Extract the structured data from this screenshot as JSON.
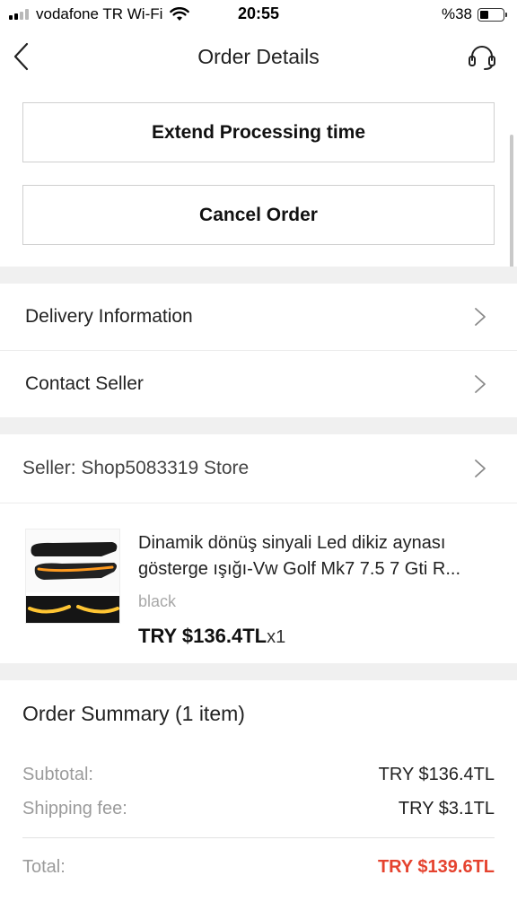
{
  "status_bar": {
    "carrier": "vodafone TR Wi-Fi",
    "time": "20:55",
    "battery_percent": "%38",
    "battery_level": 0.38,
    "signal_bars_active": 2,
    "icons": [
      "signal-icon",
      "wifi-icon",
      "battery-icon"
    ]
  },
  "header": {
    "title": "Order Details",
    "back_icon": "chevron-left-icon",
    "support_icon": "headset-icon"
  },
  "actions": {
    "extend_label": "Extend Processing time",
    "cancel_label": "Cancel Order"
  },
  "links": {
    "delivery_label": "Delivery Information",
    "contact_label": "Contact Seller"
  },
  "seller": {
    "label": "Seller: Shop5083319 Store"
  },
  "product": {
    "title": "Dinamik dönüş sinyali Led dikiz aynası gösterge ışığı-Vw Golf Mk7 7.5 7 Gti R...",
    "variant": "black",
    "price": "TRY $136.4TL",
    "quantity": "x1"
  },
  "summary": {
    "title": "Order Summary (1 item)",
    "subtotal_label": "Subtotal:",
    "subtotal_value": "TRY $136.4TL",
    "shipping_label": "Shipping fee:",
    "shipping_value": "TRY $3.1TL",
    "total_label": "Total:",
    "total_value": "TRY $139.6TL"
  },
  "colors": {
    "total_price": "#e5432f",
    "section_gap": "#f0f0f0",
    "border": "#cfcfcf"
  }
}
